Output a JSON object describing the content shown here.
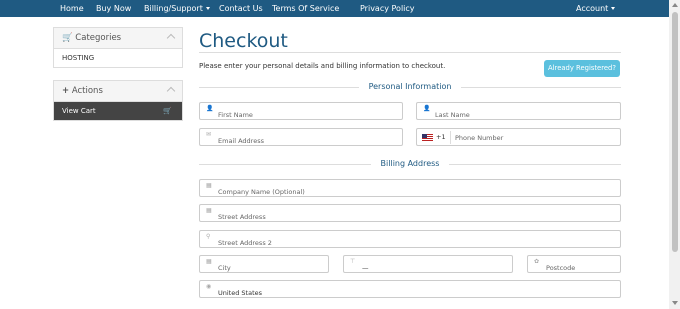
{
  "nav": {
    "items": [
      "Home",
      "Buy Now",
      "Billing/Support",
      "Contact Us",
      "Terms Of Service",
      "Privacy Policy"
    ],
    "account": "Account"
  },
  "sidebar": {
    "categories": {
      "title": "Categories",
      "item": "HOSTING"
    },
    "actions": {
      "title": "Actions",
      "item": "View Cart"
    }
  },
  "page": {
    "title": "Checkout",
    "intro": "Please enter your personal details and billing information to checkout.",
    "registered_button": "Already Registered?"
  },
  "personal": {
    "heading": "Personal Information",
    "first_name": "First Name",
    "last_name": "Last Name",
    "email": "Email Address",
    "dial_code": "+1",
    "phone": "Phone Number"
  },
  "billing": {
    "heading": "Billing Address",
    "company": "Company Name (Optional)",
    "street1": "Street Address",
    "street2": "Street Address 2",
    "city": "City",
    "state": "—",
    "postcode": "Postcode",
    "country": "United States"
  },
  "colors": {
    "nav": "#1f5a82",
    "accent": "#5bc0de"
  }
}
